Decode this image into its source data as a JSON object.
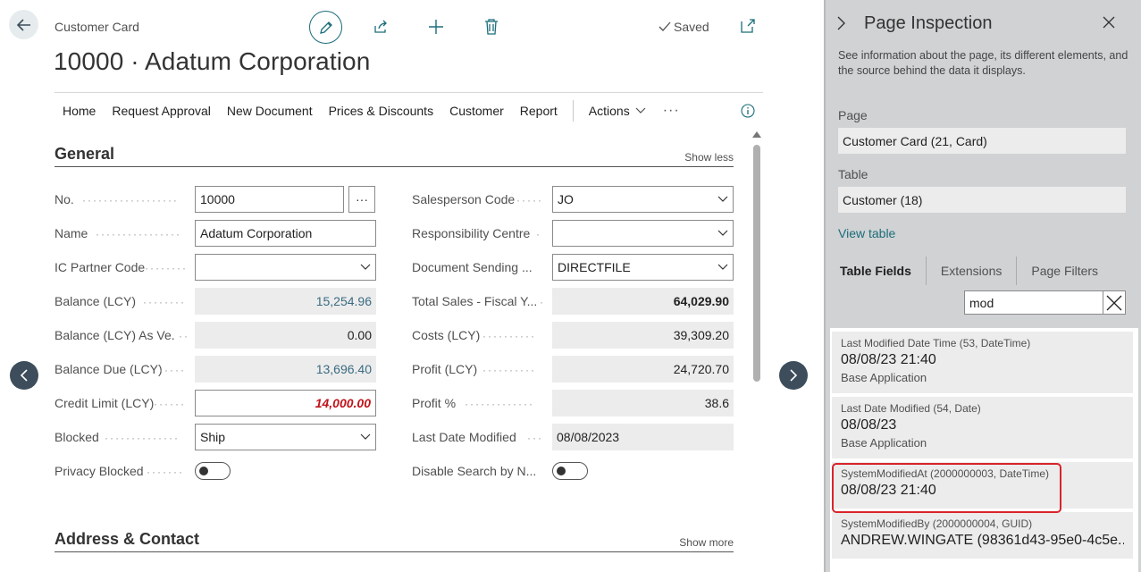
{
  "header": {
    "caption": "Customer Card",
    "title": "10000 · Adatum Corporation",
    "saved_label": "Saved"
  },
  "action_bar": {
    "items": [
      "Home",
      "Request Approval",
      "New Document",
      "Prices & Discounts",
      "Customer",
      "Report"
    ],
    "actions_label": "Actions",
    "more_label": "···"
  },
  "general": {
    "title": "General",
    "toggle": "Show less",
    "left": [
      {
        "label": "No.",
        "value": "10000"
      },
      {
        "label": "Name",
        "value": "Adatum Corporation"
      },
      {
        "label": "IC Partner Code",
        "value": ""
      },
      {
        "label": "Balance (LCY)",
        "value": "15,254.96"
      },
      {
        "label": "Balance (LCY) As Ve...",
        "value": "0.00"
      },
      {
        "label": "Balance Due (LCY)",
        "value": "13,696.40"
      },
      {
        "label": "Credit Limit (LCY)",
        "value": "14,000.00"
      },
      {
        "label": "Blocked",
        "value": "Ship"
      },
      {
        "label": "Privacy Blocked",
        "value": ""
      }
    ],
    "right": [
      {
        "label": "Salesperson Code",
        "value": "JO"
      },
      {
        "label": "Responsibility Centre",
        "value": ""
      },
      {
        "label": "Document Sending ...",
        "value": "DIRECTFILE"
      },
      {
        "label": "Total Sales - Fiscal Y...",
        "value": "64,029.90"
      },
      {
        "label": "Costs (LCY)",
        "value": "39,309.20"
      },
      {
        "label": "Profit (LCY)",
        "value": "24,720.70"
      },
      {
        "label": "Profit %",
        "value": "38.6"
      },
      {
        "label": "Last Date Modified",
        "value": "08/08/2023"
      },
      {
        "label": "Disable Search by N...",
        "value": ""
      }
    ]
  },
  "address": {
    "title": "Address & Contact",
    "toggle": "Show more"
  },
  "inspection": {
    "title": "Page Inspection",
    "description": "See information about the page, its different elements, and the source behind the data it displays.",
    "page_label": "Page",
    "page_value": "Customer Card (21, Card)",
    "table_label": "Table",
    "table_value": "Customer (18)",
    "view_table": "View table",
    "tabs": [
      "Table Fields",
      "Extensions",
      "Page Filters"
    ],
    "search_value": "mod",
    "fields": [
      {
        "head": "Last Modified Date Time (53, DateTime)",
        "value": "08/08/23 21:40",
        "ext": "Base Application"
      },
      {
        "head": "Last Date Modified (54, Date)",
        "value": "08/08/23",
        "ext": "Base Application"
      },
      {
        "head": "SystemModifiedAt (2000000003, DateTime)",
        "value": "08/08/23 21:40",
        "ext": ""
      },
      {
        "head": "SystemModifiedBy (2000000004, GUID)",
        "value": "ANDREW.WINGATE (98361d43-95e0-4c5e...",
        "ext": ""
      }
    ]
  },
  "colors": {
    "accent": "#1b6d7a",
    "highlight": "#d9242a",
    "pane_bg": "#d0d2d4"
  }
}
